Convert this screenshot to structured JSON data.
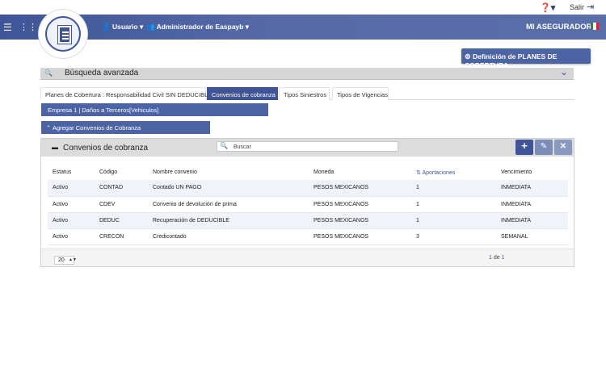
{
  "topbar": {
    "help_icon": "help-icon",
    "salir_label": "Salir",
    "exit_icon": "exit-icon"
  },
  "navbar": {
    "menu_icon": "hamburger-icon",
    "apps_icon": "grid-icon",
    "user_label": "Usuario",
    "admin_label": "Administrador de Easpayb",
    "brand": "MI ASEGURADORA",
    "colors": {
      "primary": "#3f5597",
      "flag_green": "#1e8a3c",
      "flag_red": "#cc2b2b"
    }
  },
  "definition_button": "Definición de PLANES DE COBERTURA",
  "advanced_search": {
    "title": "Búsqueda avanzada"
  },
  "tabs": [
    {
      "label": "Planes de Cobertura : Responsabilidad Civil SIN DEDUCIBLE",
      "active": false
    },
    {
      "label": "Convenios de cobranza",
      "active": true
    },
    {
      "label": "Tipos Siniestros",
      "active": false
    },
    {
      "label": "Tipos de Vigencias",
      "active": false
    }
  ],
  "empresa_label": "Empresa 1 | Daños a Terceros[Vehiculos]",
  "agregar_label": "Agregar Convenios de Cobranza",
  "panel": {
    "title": "Convenios de cobranza",
    "search_placeholder": "Buscar",
    "columns": [
      "Estatus",
      "Código",
      "Nombre convenio",
      "Moneda",
      "Aportaciones",
      "Vencimiento"
    ],
    "rows": [
      [
        "Activo",
        "CONTAD",
        "Contado UN PAGO",
        "PESOS MEXICANOS",
        "1",
        "INMEDIATA"
      ],
      [
        "Activo",
        "CDEV",
        "Convenio de devolución de prima",
        "PESOS MEXICANOS",
        "1",
        "INMEDIATA"
      ],
      [
        "Activo",
        "DEDUC",
        "Recuperación de DEDUCIBLE",
        "PESOS MEXICANOS",
        "1",
        "INMEDIATA"
      ],
      [
        "Activo",
        "CRECON",
        "Credicontado",
        "PESOS MEXICANOS",
        "3",
        "SEMANAL"
      ]
    ],
    "page_size": "20",
    "pager": {
      "current": "1",
      "de": "de",
      "total": "1"
    }
  }
}
